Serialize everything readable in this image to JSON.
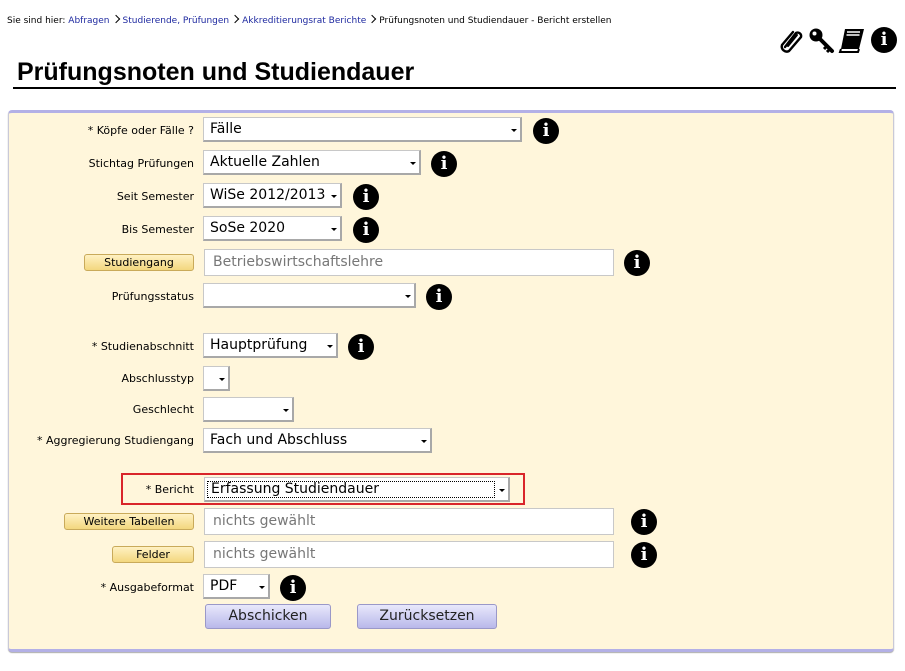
{
  "breadcrumb": {
    "prefix": "Sie sind hier:",
    "items": [
      "Abfragen",
      "Studierende, Prüfungen",
      "Akkreditierungsrat Berichte"
    ],
    "current": "Prüfungsnoten und Studiendauer - Bericht erstellen"
  },
  "toolbar": {
    "icons": [
      "paperclip-icon",
      "key-icon",
      "book-icon",
      "info-icon"
    ]
  },
  "page_title": "Prüfungsnoten und Studiendauer",
  "form": {
    "koepfe": {
      "label": "* Köpfe oder Fälle ?",
      "value": "Fälle"
    },
    "stichtag": {
      "label": "Stichtag Prüfungen",
      "value": "Aktuelle Zahlen"
    },
    "seit_semester": {
      "label": "Seit Semester",
      "value": "WiSe 2012/2013"
    },
    "bis_semester": {
      "label": "Bis Semester",
      "value": "SoSe 2020"
    },
    "studiengang": {
      "button": "Studiengang",
      "placeholder": "Betriebswirtschaftslehre"
    },
    "pruefungsstatus": {
      "label": "Prüfungsstatus",
      "value": ""
    },
    "studienabschnitt": {
      "label": "* Studienabschnitt",
      "value": "Hauptprüfung"
    },
    "abschlusstyp": {
      "label": "Abschlusstyp",
      "value": ""
    },
    "geschlecht": {
      "label": "Geschlecht",
      "value": ""
    },
    "aggregierung": {
      "label": "* Aggregierung Studiengang",
      "value": "Fach und Abschluss"
    },
    "bericht": {
      "label": "* Bericht",
      "value": "Erfassung Studiendauer"
    },
    "weitere_tabellen": {
      "button": "Weitere Tabellen",
      "placeholder": "nichts gewählt"
    },
    "felder": {
      "button": "Felder",
      "placeholder": "nichts gewählt"
    },
    "ausgabeformat": {
      "label": "* Ausgabeformat",
      "value": "PDF"
    },
    "submit": "Abschicken",
    "reset": "Zurücksetzen"
  },
  "info_glyph": "i",
  "colors": {
    "panel_bg": "#fff6db",
    "panel_border": "#b3b0e6",
    "link": "#1f2aa0",
    "highlight": "#d9252a"
  }
}
